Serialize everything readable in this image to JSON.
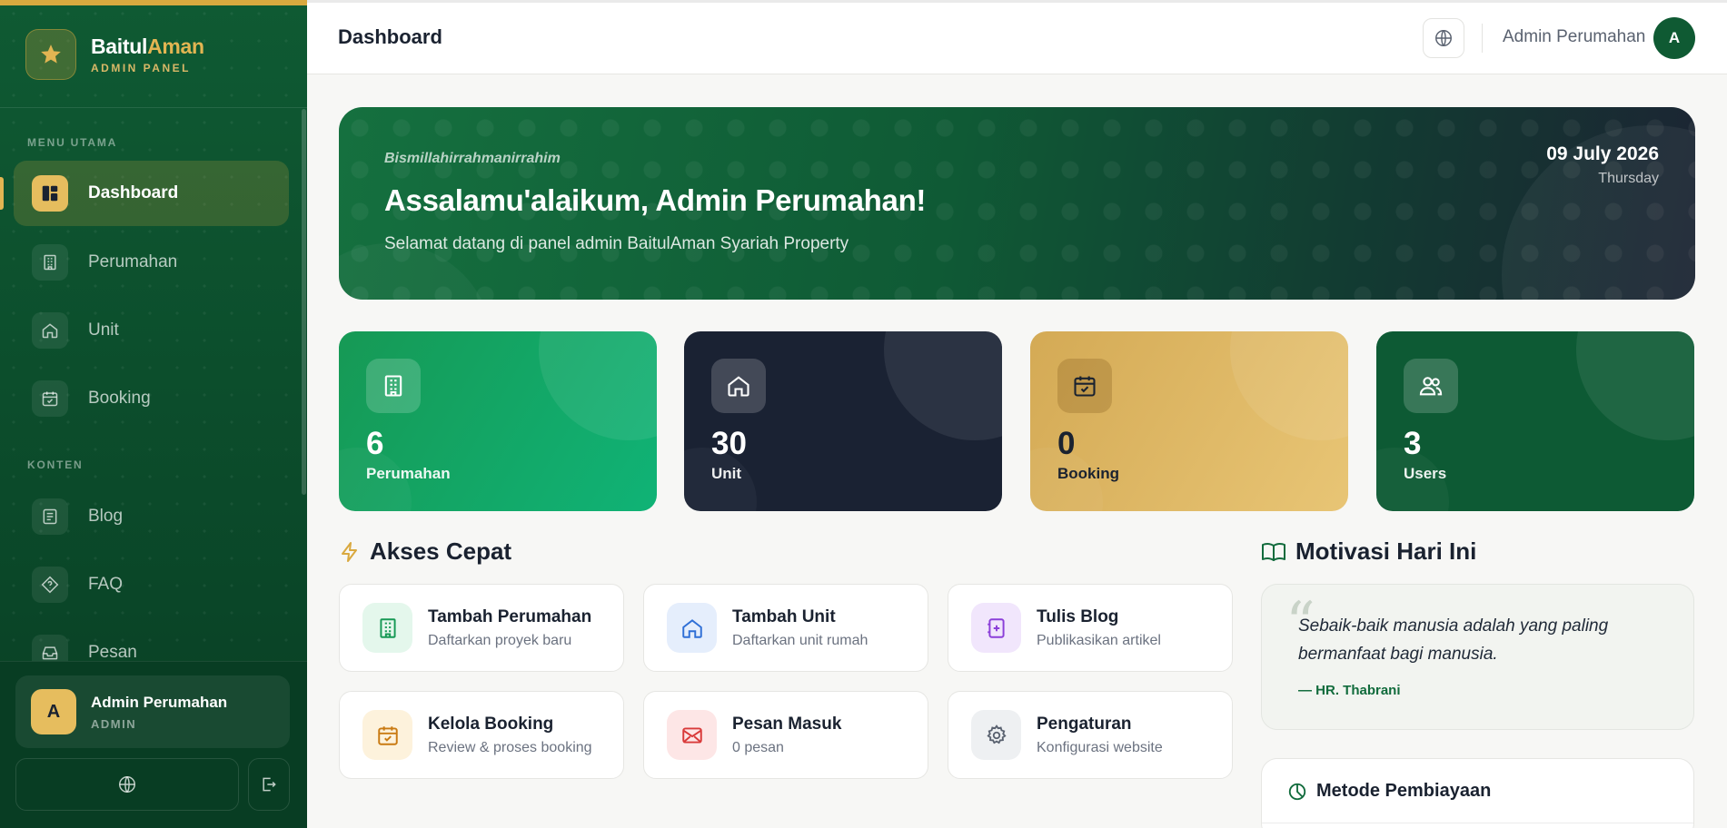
{
  "brand": {
    "name_primary": "Baitul",
    "name_accent": "Aman",
    "subtitle": "ADMIN PANEL"
  },
  "sidebar": {
    "sections": [
      {
        "label": "MENU UTAMA"
      },
      {
        "label": "KONTEN"
      }
    ],
    "items": [
      {
        "label": "Dashboard",
        "icon": "dashboard-icon",
        "active": true
      },
      {
        "label": "Perumahan",
        "icon": "building-icon"
      },
      {
        "label": "Unit",
        "icon": "home-icon"
      },
      {
        "label": "Booking",
        "icon": "calendar-check-icon"
      },
      {
        "label": "Blog",
        "icon": "newspaper-icon"
      },
      {
        "label": "FAQ",
        "icon": "help-diamond-icon"
      },
      {
        "label": "Pesan",
        "icon": "inbox-icon"
      }
    ],
    "user": {
      "initial": "A",
      "name": "Admin Perumahan",
      "role": "ADMIN"
    }
  },
  "header": {
    "title": "Dashboard",
    "user_name": "Admin Perumahan",
    "avatar_initial": "A"
  },
  "hero": {
    "greeting": "Bismillahirrahmanirrahim",
    "title": "Assalamu'alaikum, Admin Perumahan!",
    "subtitle": "Selamat datang di panel admin BaitulAman Syariah Property",
    "date": "09 July 2026",
    "day": "Thursday"
  },
  "stats": [
    {
      "value": "6",
      "label": "Perumahan",
      "icon": "building-icon"
    },
    {
      "value": "30",
      "label": "Unit",
      "icon": "home-icon"
    },
    {
      "value": "0",
      "label": "Booking",
      "icon": "calendar-check-icon"
    },
    {
      "value": "3",
      "label": "Users",
      "icon": "users-icon"
    }
  ],
  "quick_access": {
    "title": "Akses Cepat",
    "items": [
      {
        "title": "Tambah Perumahan",
        "desc": "Daftarkan proyek baru",
        "icon": "building-icon",
        "color": "#169955",
        "bg": "#e4f7ec"
      },
      {
        "title": "Tambah Unit",
        "desc": "Daftarkan unit rumah",
        "icon": "home-icon",
        "color": "#2f6fd6",
        "bg": "#e5eefc"
      },
      {
        "title": "Tulis Blog",
        "desc": "Publikasikan artikel",
        "icon": "add-note-icon",
        "color": "#8b3fd9",
        "bg": "#f1e6fc"
      },
      {
        "title": "Kelola Booking",
        "desc": "Review & proses booking",
        "icon": "calendar-check-icon",
        "color": "#c97a12",
        "bg": "#fdf2dc"
      },
      {
        "title": "Pesan Masuk",
        "desc": "0 pesan",
        "icon": "mail-icon",
        "color": "#d93a3a",
        "bg": "#fde6e6"
      },
      {
        "title": "Pengaturan",
        "desc": "Konfigurasi website",
        "icon": "gear-icon",
        "color": "#5a6270",
        "bg": "#eef0f2"
      }
    ]
  },
  "motivation": {
    "title": "Motivasi Hari Ini",
    "quote": "Sebaik-baik manusia adalah yang paling bermanfaat bagi manusia.",
    "source": "— HR. Thabrani"
  },
  "financing": {
    "title": "Metode Pembiayaan"
  }
}
